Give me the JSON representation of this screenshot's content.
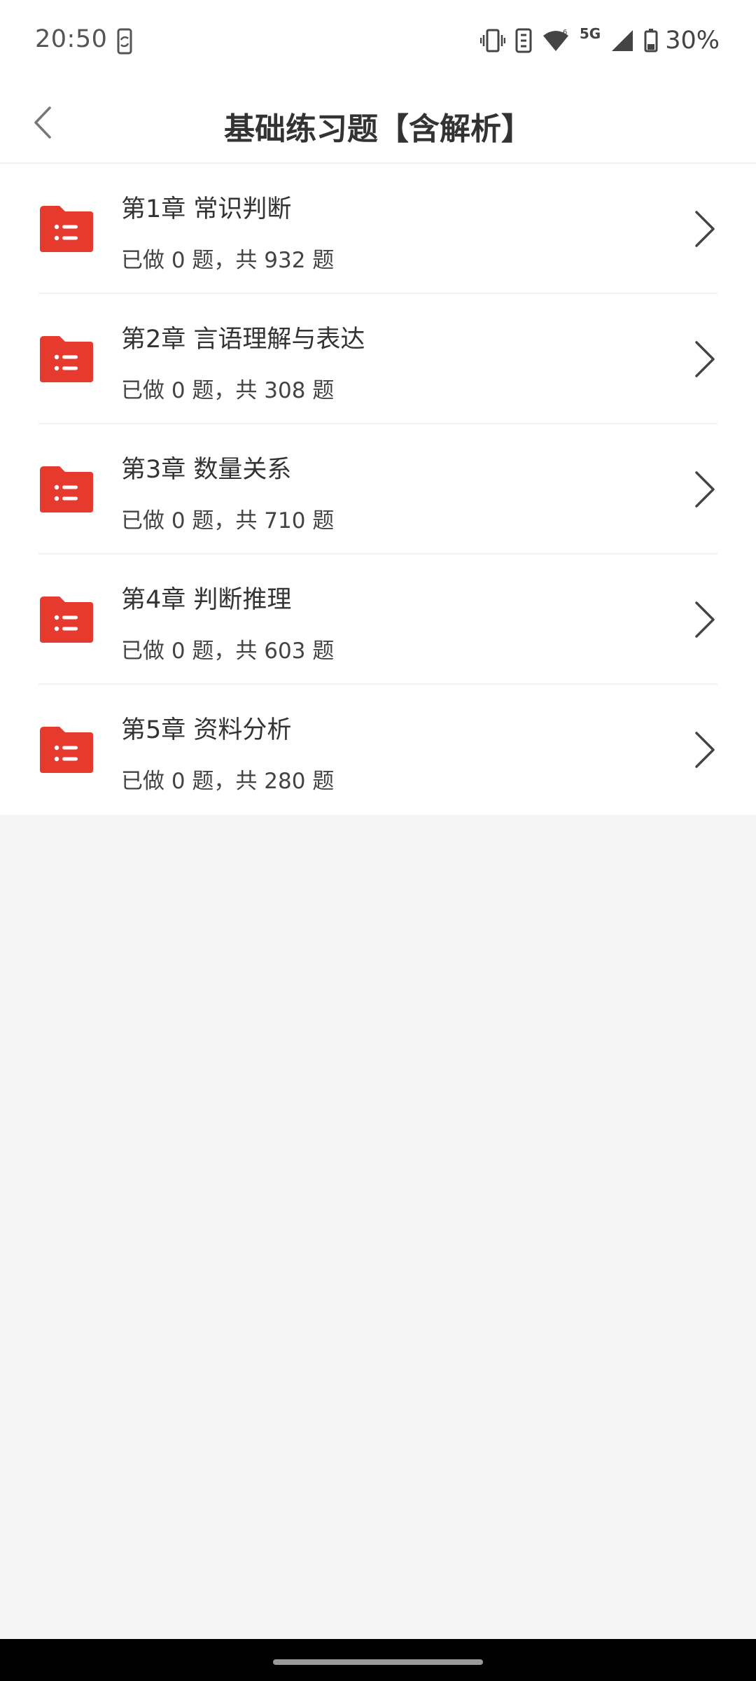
{
  "status_bar": {
    "time": "20:50",
    "network": "5G",
    "battery": "30%"
  },
  "header": {
    "title": "基础练习题【含解析】"
  },
  "chapters": [
    {
      "title": "第1章 常识判断",
      "progress": "已做 0 题，共 932 题"
    },
    {
      "title": "第2章 言语理解与表达",
      "progress": "已做 0 题，共 308 题"
    },
    {
      "title": "第3章 数量关系",
      "progress": "已做 0 题，共 710 题"
    },
    {
      "title": "第4章 判断推理",
      "progress": "已做 0 题，共 603 题"
    },
    {
      "title": "第5章 资料分析",
      "progress": "已做 0 题，共 280 题"
    }
  ],
  "colors": {
    "accent": "#e63a2e",
    "background": "#f5f5f5",
    "surface": "#ffffff"
  },
  "icons": {
    "back": "chevron-left-icon",
    "folder": "folder-list-icon",
    "row_arrow": "chevron-right-icon"
  }
}
